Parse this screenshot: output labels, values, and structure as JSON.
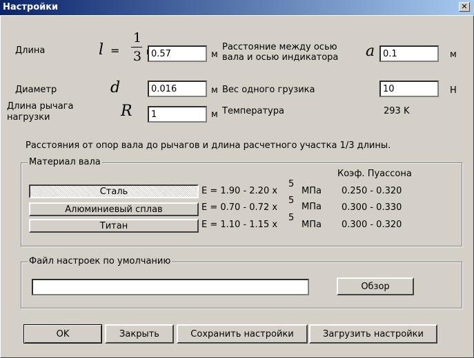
{
  "window": {
    "title": "Настройки",
    "close_label": "✕"
  },
  "length": {
    "label": "Длина",
    "symbol": "l",
    "equals": "=",
    "num": "1",
    "den": "3",
    "value": "0.57",
    "unit": "м"
  },
  "distance": {
    "label_line1": "Расстояние между осью",
    "label_line2": "вала и осью индикатора",
    "symbol": "a",
    "value": "0.1",
    "unit": "м"
  },
  "diameter": {
    "label": "Диаметр",
    "symbol": "d",
    "value": "0.016",
    "unit": "м"
  },
  "weight": {
    "label": "Вес одного грузика",
    "value": "10",
    "unit": "Н"
  },
  "lever": {
    "label_line1": "Длина рычага",
    "label_line2": "нагрузки",
    "symbol": "R",
    "value": "1",
    "unit": "м"
  },
  "temperature": {
    "label": "Температура",
    "value": "293 K"
  },
  "note": "Расстояния от опор вала до рычагов и длина расчетного участка 1/3 длины.",
  "material": {
    "group_title": "Материал вала",
    "poisson_header": "Коэф. Пуассона",
    "items": [
      {
        "name": "Сталь",
        "modulus": "E = 1.90 - 2.20 x",
        "exp": "5",
        "unit": "МПа",
        "poisson": "0.250 - 0.320"
      },
      {
        "name": "Алюминиевый сплав",
        "modulus": "E = 0.70 - 0.72 x",
        "exp": "5",
        "unit": "МПа",
        "poisson": "0.300 - 0.330"
      },
      {
        "name": "Титан",
        "modulus": "E = 1.10 - 1.15 x",
        "exp": "5",
        "unit": "МПа",
        "poisson": "0.300 - 0.320"
      }
    ]
  },
  "defaults_file": {
    "group_title": "Файл настроек по умолчанию",
    "path_value": "",
    "browse_label": "Обзор"
  },
  "buttons": {
    "ok": "OK",
    "close": "Закрыть",
    "save": "Сохранить настройки",
    "load": "Загрузить настройки"
  }
}
